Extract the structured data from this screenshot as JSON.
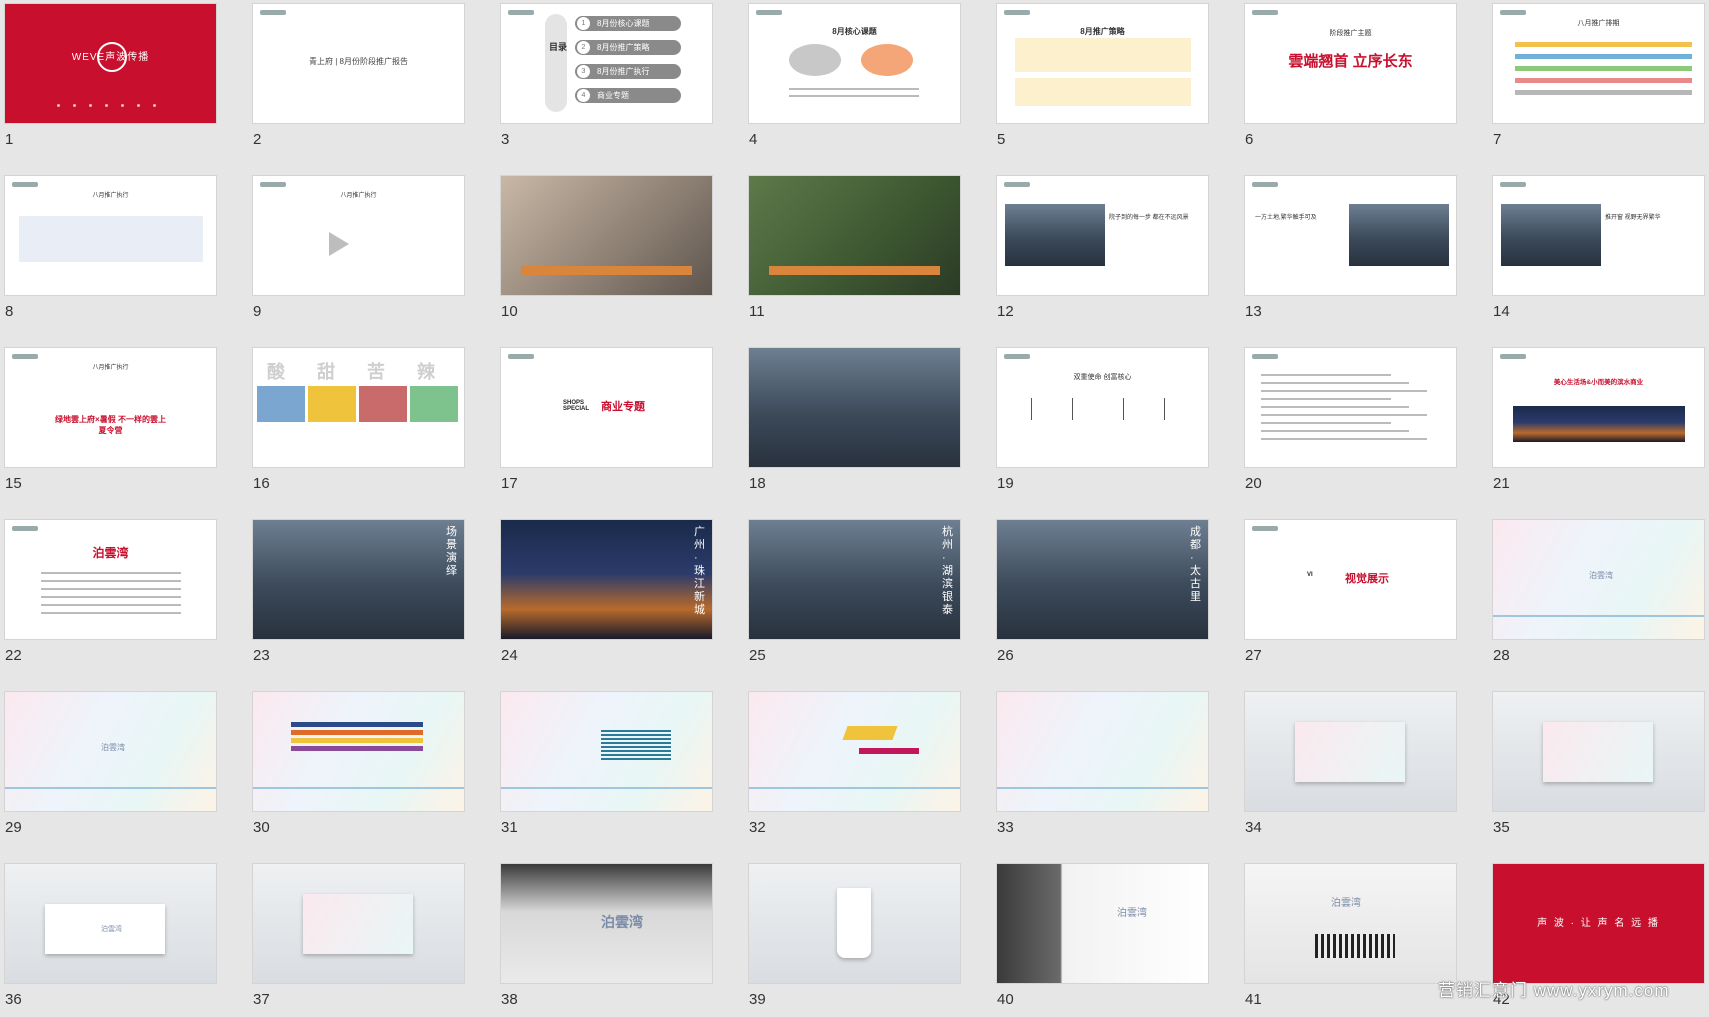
{
  "slides": [
    {
      "n": "1",
      "brand": "WEVE声波传播"
    },
    {
      "n": "2",
      "title": "青上府 | 8月份阶段推广报告"
    },
    {
      "n": "3",
      "toc_label": "目录",
      "items": [
        "8月份核心课题",
        "8月份推广策略",
        "8月份推广执行",
        "商业专题"
      ]
    },
    {
      "n": "4",
      "title": "8月核心课题"
    },
    {
      "n": "5",
      "title": "8月推广策略"
    },
    {
      "n": "6",
      "title": "阶段推广主题",
      "headline": "雲端翘首 立序长东"
    },
    {
      "n": "7",
      "title": "八月推广排期"
    },
    {
      "n": "8",
      "title": "八月推广执行"
    },
    {
      "n": "9",
      "title": "八月推广执行"
    },
    {
      "n": "10"
    },
    {
      "n": "11"
    },
    {
      "n": "12",
      "caption": "院子到的每一步 都在不远风景"
    },
    {
      "n": "13",
      "caption": "一方土地,繁华触手可及"
    },
    {
      "n": "14",
      "caption": "推开窗 视野无界繁华"
    },
    {
      "n": "15",
      "title": "八月推广执行",
      "headline": "绿地雲上府×暑假 不一样的雲上夏令营"
    },
    {
      "n": "16",
      "chars": [
        "酸",
        "甜",
        "苦",
        "辣"
      ]
    },
    {
      "n": "17",
      "en": "SHOPS SPECIAL",
      "title": "商业专题"
    },
    {
      "n": "18"
    },
    {
      "n": "19",
      "title": "双重使命 创富核心"
    },
    {
      "n": "20"
    },
    {
      "n": "21",
      "headline": "美心生活场&小而美的滨水商业"
    },
    {
      "n": "22",
      "title": "泊雲湾"
    },
    {
      "n": "23",
      "side": "场景演绎"
    },
    {
      "n": "24",
      "side": "广州·珠江新城"
    },
    {
      "n": "25",
      "side": "杭州·湖滨银泰"
    },
    {
      "n": "26",
      "side": "成都·太古里"
    },
    {
      "n": "27",
      "en": "VI",
      "title": "视觉展示"
    },
    {
      "n": "28",
      "logo": "泊雲湾"
    },
    {
      "n": "29",
      "logo": "泊雲湾"
    },
    {
      "n": "30"
    },
    {
      "n": "31"
    },
    {
      "n": "32"
    },
    {
      "n": "33"
    },
    {
      "n": "34"
    },
    {
      "n": "35"
    },
    {
      "n": "36",
      "logo": "泊雲湾"
    },
    {
      "n": "37"
    },
    {
      "n": "38",
      "logo": "泊雲湾"
    },
    {
      "n": "39"
    },
    {
      "n": "40",
      "logo": "泊雲湾"
    },
    {
      "n": "41",
      "logo": "泊雲湾"
    },
    {
      "n": "42",
      "slogan": "声 波 · 让 声 名 远 播"
    }
  ],
  "watermark": "营销汇意门 www.yxrym.com",
  "colors": {
    "brand_red": "#c8102e",
    "accent_orange": "#d9853b",
    "background": "#e6e6e6"
  }
}
